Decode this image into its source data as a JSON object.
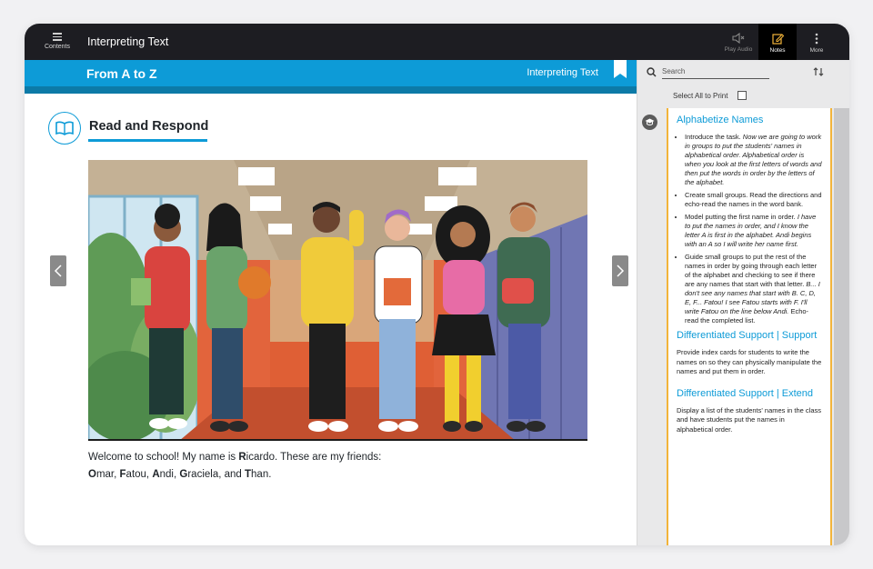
{
  "topbar": {
    "contents_label": "Contents",
    "title": "Interpreting Text",
    "play_audio_label": "Play Audio",
    "notes_label": "Notes",
    "more_label": "More"
  },
  "lesson": {
    "title": "From A to Z",
    "subtitle": "Interpreting Text"
  },
  "section": {
    "title": "Read and Respond",
    "icon": "open-book-icon"
  },
  "caption": {
    "line1_parts": [
      "Welcome to school! My name is ",
      "R",
      "icardo. These are my friends:"
    ],
    "line2_parts": [
      "O",
      "mar, ",
      "F",
      "atou, ",
      "A",
      "ndi, ",
      "G",
      "raciela, and ",
      "T",
      "han."
    ]
  },
  "panel": {
    "search_placeholder": "Search",
    "select_all_label": "Select All to Print",
    "notes": [
      {
        "heading": "Alphabetize Names",
        "bullets": [
          {
            "plain": "Introduce the task. ",
            "italic": "Now we are going to work in groups to put the students' names in alphabetical order. Alphabetical order is when you look at the first letters of words and then put the words in order by the letters of the alphabet."
          },
          {
            "plain": "Create small groups. Read the directions and echo-read the names in the word bank.",
            "italic": ""
          },
          {
            "plain": "Model putting the first name in order. ",
            "italic": "I have to put the names in order, and I know the letter A is first in the alphabet. Andi begins with an A so I will write her name first."
          },
          {
            "plain": "Guide small groups to put the rest of the names in order by going through each letter of the alphabet and checking to see if there are any names that start with that letter. ",
            "italic": "B... I don't see any names that start with B. C, D, E, F... Fatou! I see Fatou starts with F. I'll write Fatou on the line below Andi.",
            "tail": " Echo-read the completed list."
          }
        ]
      },
      {
        "heading": "Differentiated Support | Support",
        "text": "Provide index cards for students to write the names on so they can physically manipulate the names and put them in order."
      },
      {
        "heading": "Differentiated Support | Extend",
        "text": "Display a list of the students' names in the class and have students put the names in alphabetical order."
      }
    ]
  },
  "colors": {
    "accent_blue": "#0d9bd7",
    "notes_border": "#f2b43a",
    "topbar": "#1d1d22"
  }
}
